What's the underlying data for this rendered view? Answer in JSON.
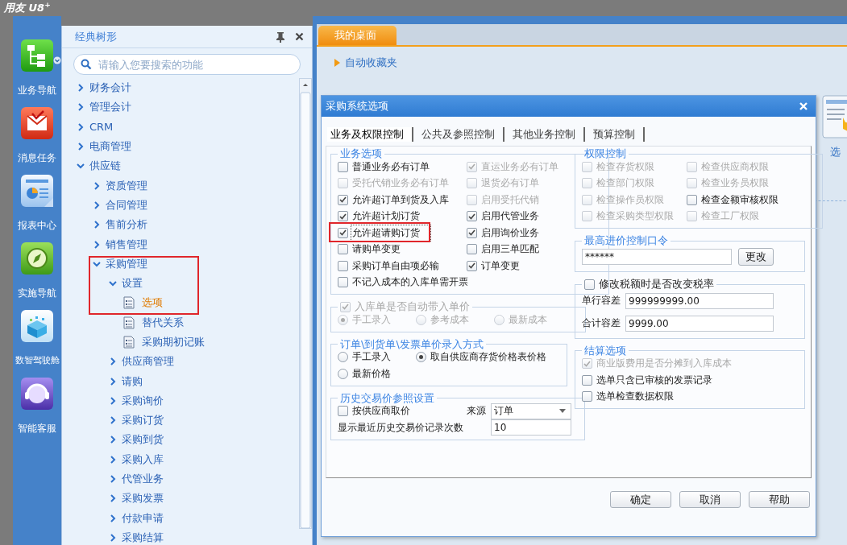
{
  "app": {
    "logo": "用友 U8$^{+}$"
  },
  "nav": [
    {
      "label": "业务导航"
    },
    {
      "label": "消息任务"
    },
    {
      "label": "报表中心"
    },
    {
      "label": "实施导航"
    },
    {
      "label": "数智驾驶舱"
    },
    {
      "label": "智能客服"
    }
  ],
  "tree_panel": {
    "title": "经典树形",
    "search": {
      "placeholder": "请输入您要搜索的功能"
    },
    "nodes": [
      {
        "label": "财务会计",
        "kind": "branch",
        "expanded": false,
        "selected": false
      },
      {
        "label": "管理会计",
        "kind": "branch",
        "expanded": false,
        "selected": false
      },
      {
        "label": "CRM",
        "kind": "branch",
        "expanded": false,
        "selected": false
      },
      {
        "label": "电商管理",
        "kind": "branch",
        "expanded": false,
        "selected": false
      },
      {
        "label": "供应链",
        "kind": "branch",
        "expanded": true,
        "selected": false,
        "children": [
          {
            "label": "资质管理",
            "kind": "branch",
            "expanded": false,
            "selected": false
          },
          {
            "label": "合同管理",
            "kind": "branch",
            "expanded": false,
            "selected": false
          },
          {
            "label": "售前分析",
            "kind": "branch",
            "expanded": false,
            "selected": false
          },
          {
            "label": "销售管理",
            "kind": "branch",
            "expanded": false,
            "selected": false
          },
          {
            "label": "采购管理",
            "kind": "branch",
            "expanded": true,
            "selected": false,
            "children": [
              {
                "label": "设置",
                "kind": "branch",
                "expanded": true,
                "selected": false,
                "children": [
                  {
                    "label": "选项",
                    "kind": "leaf",
                    "selected": true
                  },
                  {
                    "label": "替代关系",
                    "kind": "leaf",
                    "selected": false
                  },
                  {
                    "label": "采购期初记账",
                    "kind": "leaf",
                    "selected": false
                  }
                ]
              },
              {
                "label": "供应商管理",
                "kind": "branch",
                "expanded": false,
                "selected": false
              },
              {
                "label": "请购",
                "kind": "branch",
                "expanded": false,
                "selected": false
              },
              {
                "label": "采购询价",
                "kind": "branch",
                "expanded": false,
                "selected": false
              },
              {
                "label": "采购订货",
                "kind": "branch",
                "expanded": false,
                "selected": false
              },
              {
                "label": "采购到货",
                "kind": "branch",
                "expanded": false,
                "selected": false
              },
              {
                "label": "采购入库",
                "kind": "branch",
                "expanded": false,
                "selected": false
              },
              {
                "label": "代管业务",
                "kind": "branch",
                "expanded": false,
                "selected": false
              },
              {
                "label": "采购发票",
                "kind": "branch",
                "expanded": false,
                "selected": false
              },
              {
                "label": "付款申请",
                "kind": "branch",
                "expanded": false,
                "selected": false
              },
              {
                "label": "采购结算",
                "kind": "branch",
                "expanded": false,
                "selected": false
              }
            ]
          }
        ]
      }
    ]
  },
  "desk": {
    "tabs": [
      {
        "label": "我的桌面",
        "selected": true
      }
    ],
    "favorites": {
      "label": "自动收藏夹",
      "expanded": false
    },
    "shortcut": {
      "label": "选"
    }
  },
  "dialog": {
    "title": "采购系统选项",
    "tabs": [
      {
        "label": "业务及权限控制",
        "selected": true
      },
      {
        "label": "公共及参照控制",
        "selected": false
      },
      {
        "label": "其他业务控制",
        "selected": false
      },
      {
        "label": "预算控制",
        "selected": false
      }
    ],
    "columns": [
      {
        "groups": [
          {
            "legend": {
              "kind": "text",
              "label": "业务选项"
            },
            "rows": [
              [
                {
                  "kind": "checkbox",
                  "label": "普通业务必有订单",
                  "checked": false,
                  "disabled": false,
                  "focused": false
                },
                {
                  "kind": "checkbox",
                  "label": "直运业务必有订单",
                  "checked": true,
                  "disabled": true,
                  "focused": false
                }
              ],
              [
                {
                  "kind": "checkbox",
                  "label": "受托代销业务必有订单",
                  "checked": false,
                  "disabled": true,
                  "focused": false
                },
                {
                  "kind": "checkbox",
                  "label": "退货必有订单",
                  "checked": false,
                  "disabled": true,
                  "focused": false
                }
              ],
              [
                {
                  "kind": "checkbox",
                  "label": "允许超订单到货及入库",
                  "checked": true,
                  "disabled": false,
                  "focused": false
                },
                {
                  "kind": "checkbox",
                  "label": "启用受托代销",
                  "checked": false,
                  "disabled": true,
                  "focused": false
                }
              ],
              [
                {
                  "kind": "checkbox",
                  "label": "允许超计划订货",
                  "checked": true,
                  "disabled": false,
                  "focused": false
                },
                {
                  "kind": "checkbox",
                  "label": "启用代管业务",
                  "checked": true,
                  "disabled": false,
                  "focused": false
                }
              ],
              [
                {
                  "kind": "checkbox",
                  "label": "允许超请购订货",
                  "checked": true,
                  "disabled": false,
                  "focused": true
                },
                {
                  "kind": "checkbox",
                  "label": "启用询价业务",
                  "checked": true,
                  "disabled": false,
                  "focused": false
                }
              ],
              [
                {
                  "kind": "checkbox",
                  "label": "请购单变更",
                  "checked": false,
                  "disabled": false,
                  "focused": false
                },
                {
                  "kind": "checkbox",
                  "label": "启用三单匹配",
                  "checked": false,
                  "disabled": false,
                  "focused": false
                }
              ],
              [
                {
                  "kind": "checkbox",
                  "label": "采购订单自由项必输",
                  "checked": false,
                  "disabled": false,
                  "focused": false
                },
                {
                  "kind": "checkbox",
                  "label": "订单变更",
                  "checked": true,
                  "disabled": false,
                  "focused": false
                }
              ],
              [
                {
                  "kind": "checkbox",
                  "label": "不记入成本的入库单需开票",
                  "checked": false,
                  "disabled": false,
                  "focused": false
                }
              ]
            ]
          },
          {
            "legend": {
              "kind": "checkbox",
              "label": "入库单是否自动带入单价",
              "checked": true,
              "disabled": true
            },
            "rows": [
              [
                {
                  "kind": "radio",
                  "label": "手工录入",
                  "selected": true,
                  "disabled": true
                },
                {
                  "kind": "radio",
                  "label": "参考成本",
                  "selected": false,
                  "disabled": true
                },
                {
                  "kind": "radio",
                  "label": "最新成本",
                  "selected": false,
                  "disabled": true
                }
              ]
            ]
          },
          {
            "legend": {
              "kind": "text",
              "label": "订单\\到货单\\发票单价录入方式"
            },
            "rows": [
              [
                {
                  "kind": "radio",
                  "label": "手工录入",
                  "selected": false,
                  "disabled": false
                },
                {
                  "kind": "radio",
                  "label": "取自供应商存货价格表价格",
                  "selected": true,
                  "disabled": false
                }
              ],
              [
                {
                  "kind": "radio",
                  "label": "最新价格",
                  "selected": false,
                  "disabled": false
                }
              ]
            ]
          },
          {
            "legend": {
              "kind": "text",
              "label": "历史交易价参照设置"
            },
            "rows": [
              [
                {
                  "kind": "checkbox",
                  "label": "按供应商取价",
                  "checked": false,
                  "disabled": false
                },
                {
                  "kind": "label",
                  "text": "来源"
                },
                {
                  "kind": "dropdown",
                  "value": "订单"
                }
              ],
              [
                {
                  "kind": "label",
                  "text": "显示最近历史交易价记录次数"
                },
                "",
                {
                  "kind": "field",
                  "value": "10"
                }
              ]
            ]
          }
        ]
      },
      {
        "groups": [
          {
            "legend": {
              "kind": "text",
              "label": "权限控制"
            },
            "rows": [
              [
                {
                  "kind": "checkbox",
                  "label": "检查存货权限",
                  "checked": false,
                  "disabled": true
                },
                {
                  "kind": "checkbox",
                  "label": "检查供应商权限",
                  "checked": false,
                  "disabled": true
                }
              ],
              [
                {
                  "kind": "checkbox",
                  "label": "检查部门权限",
                  "checked": false,
                  "disabled": true
                },
                {
                  "kind": "checkbox",
                  "label": "检查业务员权限",
                  "checked": false,
                  "disabled": true
                }
              ],
              [
                {
                  "kind": "checkbox",
                  "label": "检查操作员权限",
                  "checked": false,
                  "disabled": true
                },
                {
                  "kind": "checkbox",
                  "label": "检查金额审核权限",
                  "checked": false,
                  "disabled": false
                }
              ],
              [
                {
                  "kind": "checkbox",
                  "label": "检查采购类型权限",
                  "checked": false,
                  "disabled": true
                },
                {
                  "kind": "checkbox",
                  "label": "检查工厂权限",
                  "checked": false,
                  "disabled": true
                }
              ]
            ]
          },
          {
            "legend": {
              "kind": "text",
              "label": "最高进价控制口令"
            },
            "rows": [
              [
                {
                  "kind": "field",
                  "value": "******"
                },
                {
                  "kind": "button",
                  "label": "更改"
                }
              ]
            ]
          },
          {
            "legend": {
              "kind": "checkbox",
              "label": "修改税额时是否改变税率",
              "checked": false,
              "disabled": false
            },
            "rows": [
              [
                {
                  "kind": "label",
                  "text": "单行容差"
                },
                {
                  "kind": "field",
                  "value": "999999999.00"
                }
              ],
              [
                {
                  "kind": "label",
                  "text": "合计容差"
                },
                {
                  "kind": "field",
                  "value": "9999.00"
                }
              ]
            ]
          },
          {
            "legend": {
              "kind": "text",
              "label": "结算选项"
            },
            "rows": [
              [
                {
                  "kind": "checkbox",
                  "label": "商业版费用是否分摊到入库成本",
                  "checked": true,
                  "disabled": true
                }
              ],
              [
                {
                  "kind": "checkbox",
                  "label": "选单只含已审核的发票记录",
                  "checked": false,
                  "disabled": false
                }
              ],
              [
                {
                  "kind": "checkbox",
                  "label": "选单检查数据权限",
                  "checked": false,
                  "disabled": false
                }
              ]
            ]
          }
        ]
      }
    ],
    "buttons": [
      "确定",
      "取消",
      "帮助"
    ]
  },
  "red_frames": [
    {
      "kind": "rectangle"
    },
    {
      "kind": "rectangle"
    }
  ]
}
